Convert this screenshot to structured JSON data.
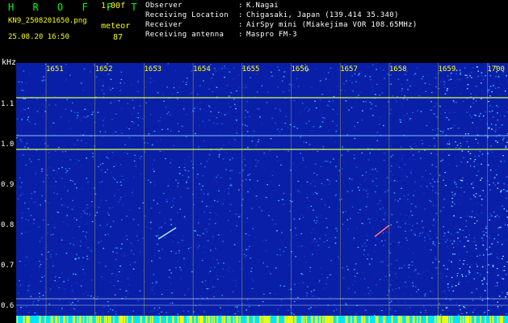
{
  "header": {
    "logo": "H R O F F T",
    "version": "1.00f",
    "file_name": "KN9_2508201650.png",
    "meteor_label": "meteor",
    "timestamp": "25.08.20 16:50",
    "meteor_count": "87",
    "info": [
      {
        "label": "Observer",
        "value": "K.Nagai"
      },
      {
        "label": "Receiving Location",
        "value": "Chigasaki, Japan (139.414 35.340)"
      },
      {
        "label": "Receiver",
        "value": "AirSpy mini (Miakejima VOR 108.65MHz)"
      },
      {
        "label": "Receiving antenna",
        "value": "Maspro FM-3"
      }
    ]
  },
  "axis": {
    "y_unit": "kHz",
    "y_ticks": [
      "1.1",
      "1.0",
      "0.9",
      "0.8",
      "0.7",
      "0.6"
    ],
    "x_ticks": [
      "1651",
      "1652",
      "1653",
      "1654",
      "1655",
      "1656",
      "1657",
      "1658",
      "1659",
      "1700"
    ]
  },
  "colors": {
    "background": "#000000",
    "header_yellow": "#ffff00",
    "header_green": "#00ff00",
    "spectrogram_base": "#0a1fa8",
    "signal_line": "#d6ff4a",
    "bottom_band": "#00e5ff"
  }
}
